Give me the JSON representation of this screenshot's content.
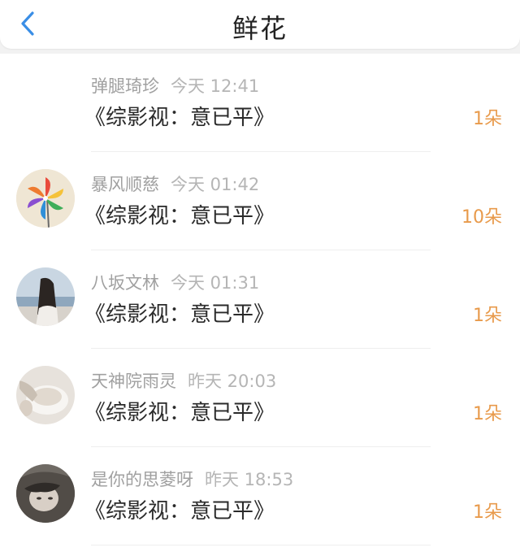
{
  "header": {
    "title": "鲜花",
    "back_icon": "chevron-left-icon"
  },
  "accent_color": "#e89a4b",
  "items": [
    {
      "name": "弹腿琦珍",
      "time": "今天 12:41",
      "book": "《综影视：意已平》",
      "count": "1朵",
      "avatar": "blank"
    },
    {
      "name": "暴风顺慈",
      "time": "今天 01:42",
      "book": "《综影视：意已平》",
      "count": "10朵",
      "avatar": "pinwheel"
    },
    {
      "name": "八坂文林",
      "time": "今天 01:31",
      "book": "《综影视：意已平》",
      "count": "1朵",
      "avatar": "girl-by-sea"
    },
    {
      "name": "天神院雨灵",
      "time": "昨天 20:03",
      "book": "《综影视：意已平》",
      "count": "1朵",
      "avatar": "tea-cup"
    },
    {
      "name": "是你的思菱呀",
      "time": "昨天 18:53",
      "book": "《综影视：意已平》",
      "count": "1朵",
      "avatar": "woman-portrait"
    }
  ]
}
